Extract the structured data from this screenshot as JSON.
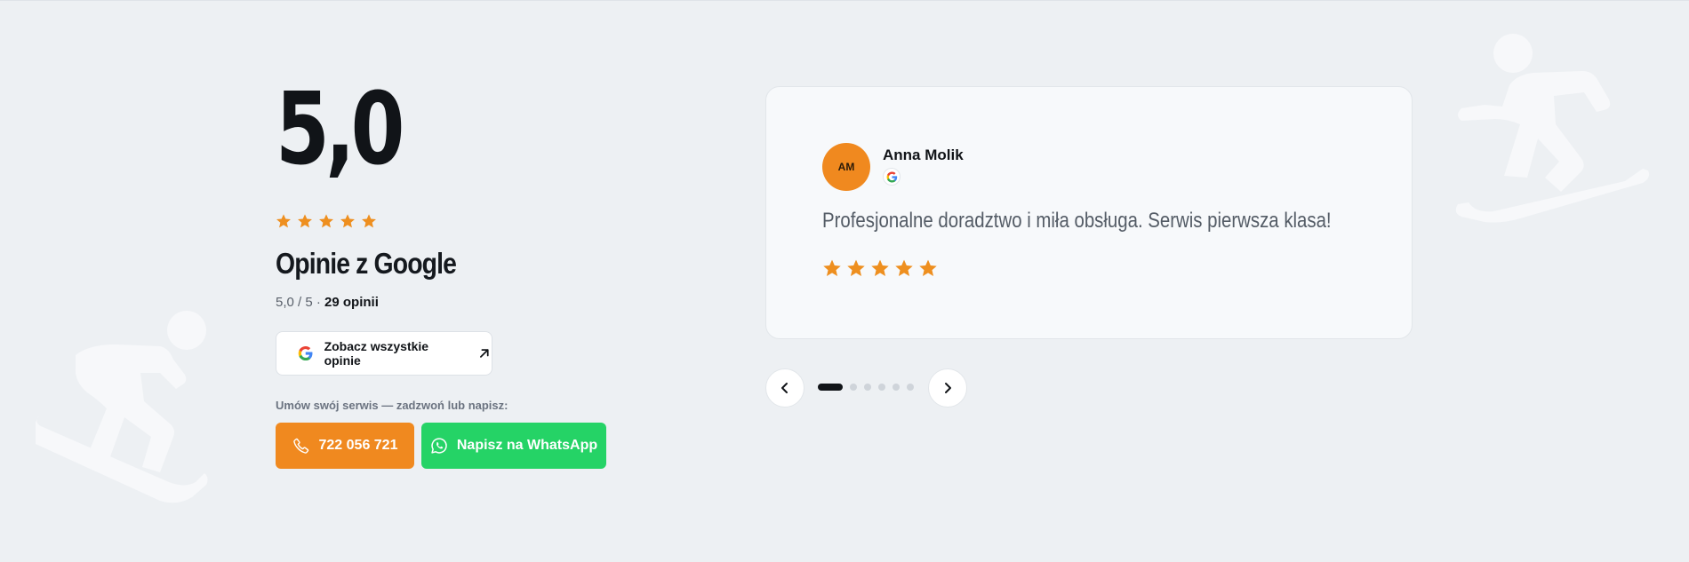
{
  "rating": {
    "value": "5,0",
    "stars": 5,
    "heading": "Opinie z Google",
    "summary_prefix": "5,0 / 5 · ",
    "summary_count": "29 opinii"
  },
  "buttons": {
    "all_reviews_label": "Zobacz wszystkie opinie",
    "cta_label": "Umów swój serwis — zadzwoń lub napisz:",
    "phone_label": "722 056 721",
    "whatsapp_label": "Napisz na WhatsApp"
  },
  "review": {
    "initials": "AM",
    "author": "Anna Molik",
    "text": "Profesjonalne doradztwo i miła obsługa. Serwis pierwsza klasa!",
    "stars": 5
  },
  "carousel": {
    "total_slides": 6,
    "active_index": 0
  },
  "icons": {
    "google": "google-icon",
    "external": "arrow-up-right-icon",
    "phone": "phone-icon",
    "whatsapp": "whatsapp-icon",
    "prev": "chevron-left-icon",
    "next": "chevron-right-icon",
    "decoration": "snowboarder-icon"
  },
  "colors": {
    "accent": "#f0891f",
    "whatsapp": "#25d366",
    "star": "#ee8f1f",
    "background": "#edf0f3"
  }
}
